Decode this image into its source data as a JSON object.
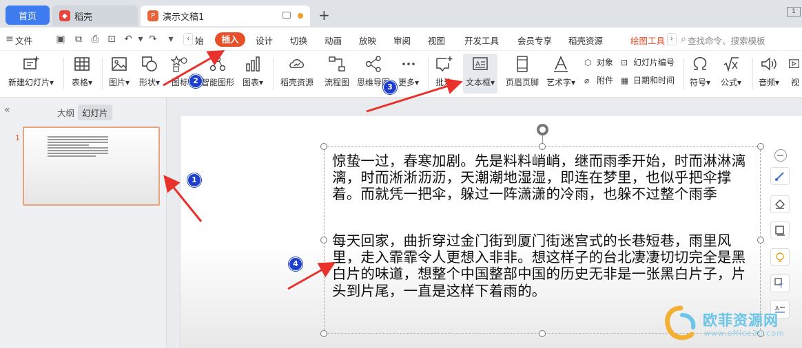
{
  "tabs": {
    "home": "首页",
    "daoke": "稻壳",
    "doc": "演示文稿1"
  },
  "window": {
    "restore": "1"
  },
  "menu": {
    "file": "文件",
    "start_partial": "始",
    "insert": "插入",
    "design": "设计",
    "transition": "切换",
    "animation": "动画",
    "slideshow": "放映",
    "review": "审阅",
    "view": "视图",
    "developer": "开发工具",
    "member": "会员专享",
    "daoke_resources": "稻壳资源",
    "drawing_tools": "绘图工具",
    "search": "查找命令、搜索模板"
  },
  "ribbon": {
    "new_slide": "新建幻灯片",
    "table": "表格",
    "picture": "图片",
    "shape": "形状",
    "icon": "图标",
    "smart_graphic": "智能图形",
    "chart": "图表",
    "daoke_resource": "稻壳资源",
    "flowchart": "流程图",
    "mindmap": "思维导图",
    "more": "更多",
    "comment": "批注",
    "text_box": "文本框",
    "header_footer": "页眉页脚",
    "art_text": "艺术字",
    "object": "对象",
    "slide_number": "幻灯片编号",
    "attachment": "附件",
    "date_time": "日期和时间",
    "symbol": "符号",
    "formula": "公式",
    "audio": "音频",
    "video": "视"
  },
  "left_panel": {
    "outline": "大纲",
    "slides": "幻灯片",
    "slide_number": "1"
  },
  "slide": {
    "paragraph1": "惊蛰一过，春寒加剧。先是料料峭峭，继而雨季开始，时而淋淋漓漓，时而淅淅沥沥，天潮潮地湿湿，即连在梦里，也似乎把伞撑着。而就凭一把伞，躲过一阵潇潇的冷雨，也躲不过整个雨季",
    "paragraph2": "每天回家，曲折穿过金门街到厦门街迷宫式的长巷短巷，雨里风里，走入霏霏令人更想入非非。想这样子的台北凄凄切切完全是黑白片的味道，想整个中国整部中国的历史无非是一张黑白片子，片头到片尾，一直是这样下着雨的。"
  },
  "annotations": {
    "b1": "1",
    "b2": "2",
    "b3": "3",
    "b4": "4",
    "color": "#e8312a"
  },
  "watermark": {
    "name": "欧菲资源网",
    "url": "www.office26.com"
  },
  "colors": {
    "accent": "#e8502a",
    "home_tab": "#3e7cf0",
    "badge": "#1d3fcf"
  }
}
